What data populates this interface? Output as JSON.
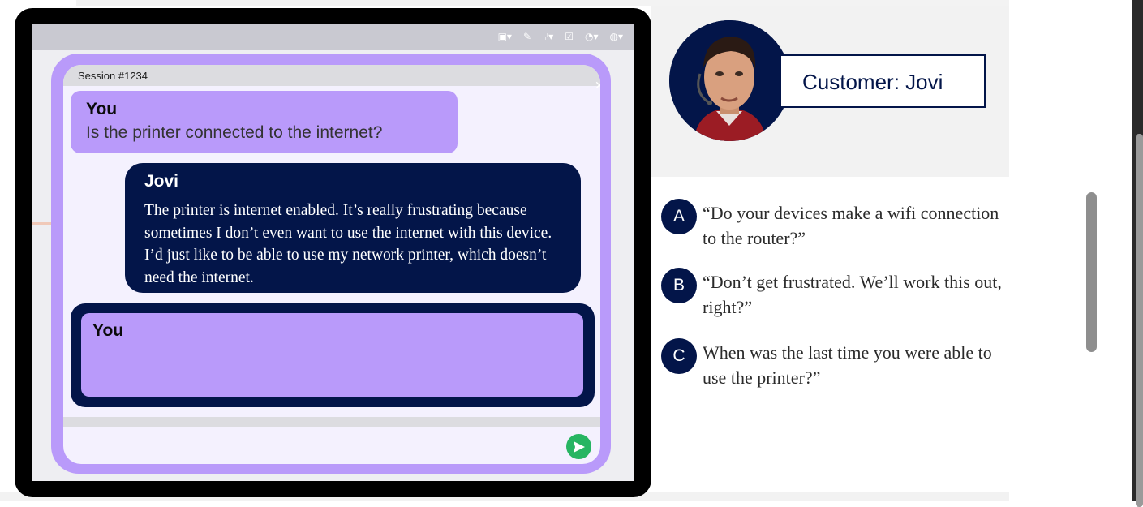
{
  "chat": {
    "session_label": "Session #1234",
    "messages": [
      {
        "sender": "You",
        "text": "Is the printer connected to the internet?"
      },
      {
        "sender": "Jovi",
        "text": "The printer is internet enabled. It’s really frustrating because sometimes I don’t even want to use the internet with this device. I’d just like to be able to use my network printer, which doesn’t need the internet."
      }
    ],
    "reply_sender": "You",
    "send_icon": "send-arrow-icon"
  },
  "customer": {
    "label": "Customer: Jovi"
  },
  "options": [
    {
      "letter": "A",
      "text": "“Do your devices make a wifi connection to the router?”"
    },
    {
      "letter": "B",
      "text": "“Don’t get frustrated. We’ll work this out, right?”"
    },
    {
      "letter": "C",
      "text": "When was the last time you were able to use the printer?”"
    }
  ],
  "colors": {
    "navy": "#031549",
    "lavender": "#b99afa",
    "send_green": "#27b562"
  }
}
